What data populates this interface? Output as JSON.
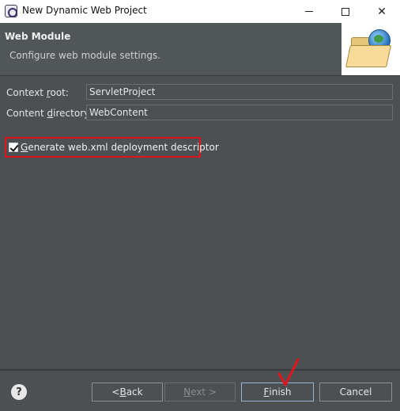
{
  "window": {
    "title": "New Dynamic Web Project"
  },
  "header": {
    "title": "Web Module",
    "description": "Configure web module settings."
  },
  "form": {
    "context_root": {
      "label_pre": "Context ",
      "label_mnemonic": "r",
      "label_post": "oot:",
      "value": "ServletProject"
    },
    "content_directory": {
      "label_pre": "Content ",
      "label_mnemonic": "d",
      "label_post": "irectory:",
      "value": "WebContent"
    }
  },
  "checkbox": {
    "checked": true,
    "label_mnemonic": "G",
    "label_rest": "enerate web.xml deployment descriptor"
  },
  "buttons": {
    "help": "?",
    "back_pre": "< ",
    "back_mnemonic": "B",
    "back_post": "ack",
    "next_mnemonic": "N",
    "next_post": "ext >",
    "finish_mnemonic": "F",
    "finish_post": "inish",
    "cancel": "Cancel"
  },
  "colors": {
    "highlight_border": "#e0141e",
    "background": "#4d5052"
  }
}
